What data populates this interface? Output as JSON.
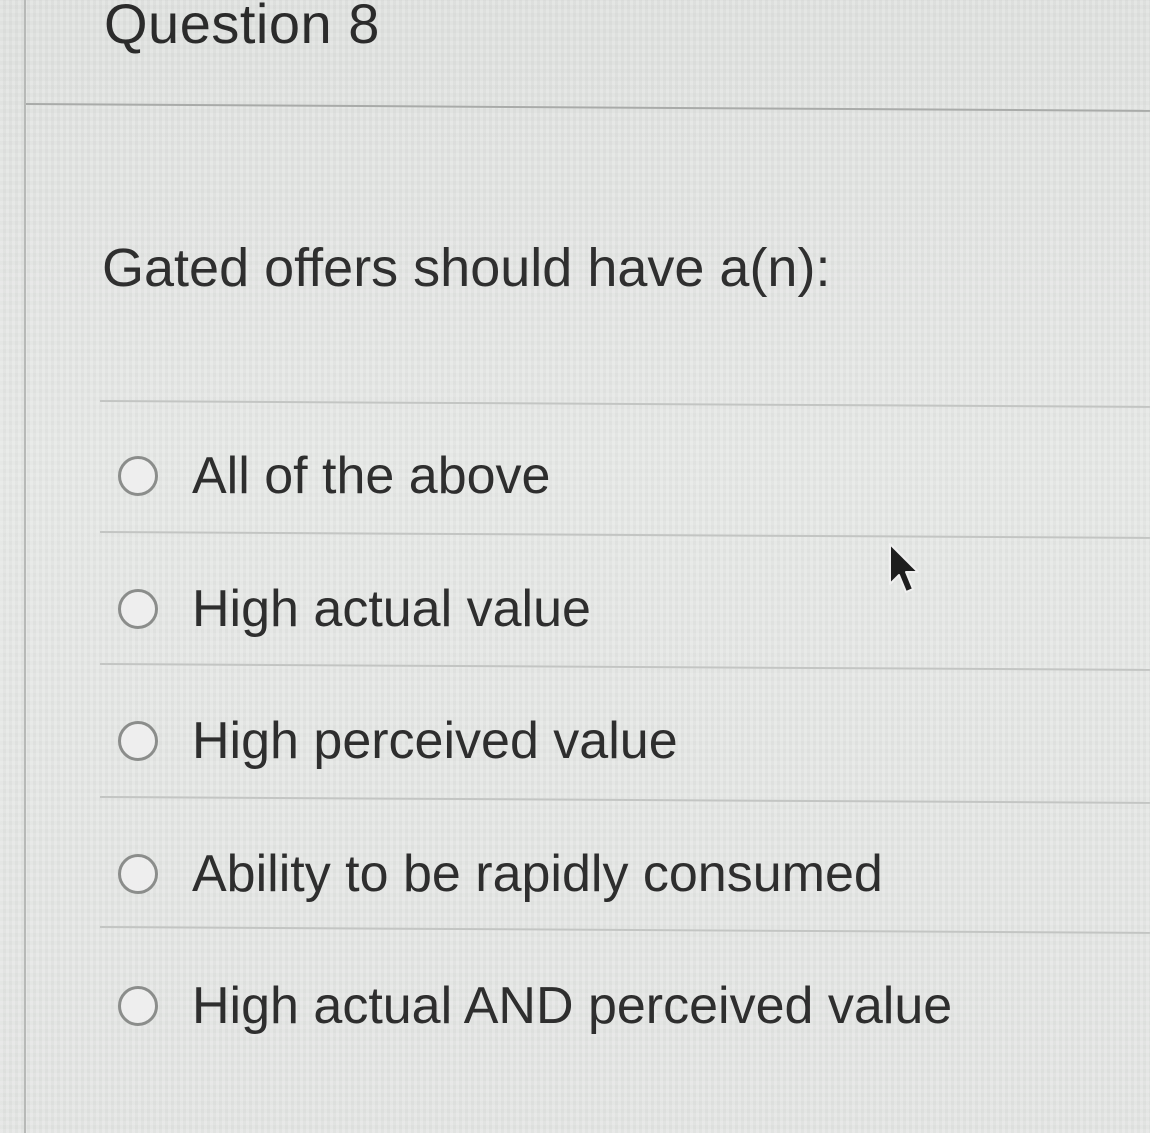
{
  "question": {
    "title": "Question 8",
    "prompt": "Gated offers should have a(n):"
  },
  "options": [
    {
      "label": "All of the above",
      "selected": false
    },
    {
      "label": "High actual value",
      "selected": false
    },
    {
      "label": "High perceived value",
      "selected": false
    },
    {
      "label": "Ability to be rapidly consumed",
      "selected": false
    },
    {
      "label": "High actual AND perceived value",
      "selected": false
    }
  ],
  "icons": {
    "radio": "radio-unselected-icon",
    "pointer": "mouse-pointer-icon"
  },
  "colors": {
    "background": "#e4e6e4",
    "text": "#2e2e2e",
    "divider": "#c3c5c3",
    "radio_border": "#8b8d8b"
  }
}
